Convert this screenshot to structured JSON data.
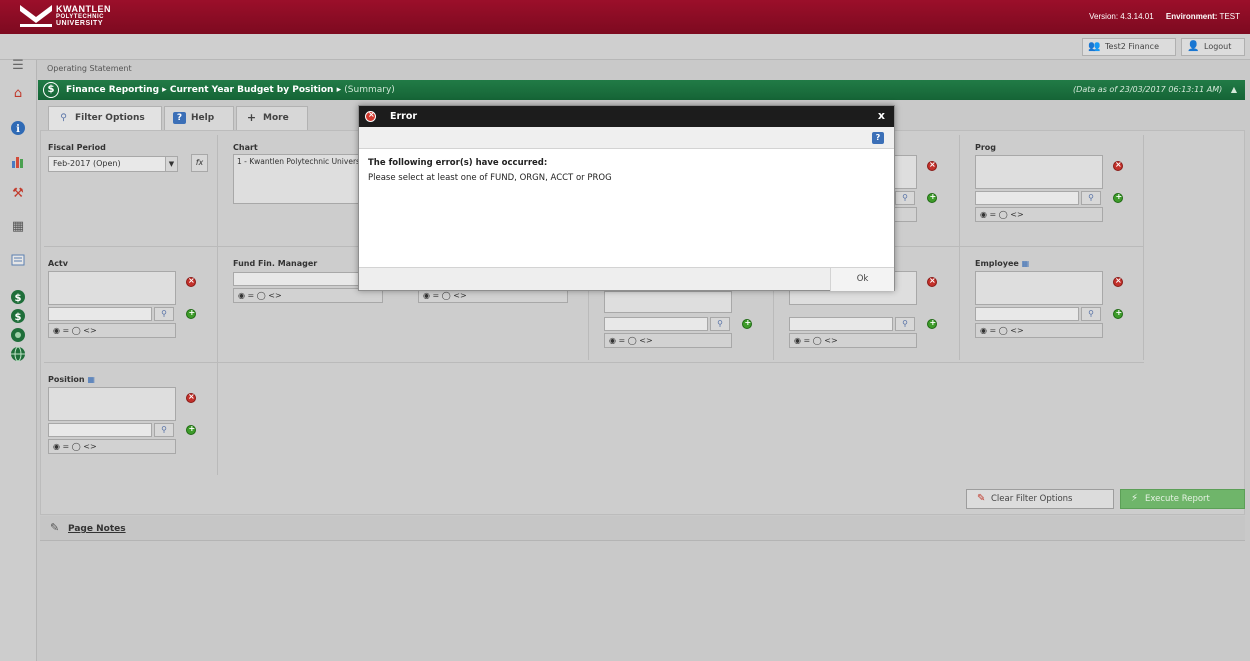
{
  "brand": {
    "line1": "KWANTLEN",
    "line2": "POLYTECHNIC",
    "line3": "UNIVERSITY"
  },
  "header": {
    "version_label": "Version:",
    "version": "4.3.14.01",
    "env_label": "Environment:",
    "env": "TEST"
  },
  "userbar": {
    "user": "Test2 Finance",
    "logout": "Logout"
  },
  "page": {
    "section": "Operating Statement"
  },
  "breadcrumb": {
    "item1": "Finance Reporting",
    "sep": "▸",
    "item2": "Current Year Budget by Position",
    "item3": "(Summary)",
    "as_of": "(Data as of 23/03/2017 06:13:11 AM)",
    "collapse": "▲"
  },
  "tabs": {
    "filter": "Filter Options",
    "help": "Help",
    "more": "More"
  },
  "filters": {
    "fiscal_period": {
      "label": "Fiscal Period",
      "value": "Feb-2017 (Open)",
      "fx": "fx"
    },
    "chart": {
      "label": "Chart",
      "value": "1 - Kwantlen Polytechnic University"
    },
    "prog": {
      "label": "Prog"
    },
    "actv": {
      "label": "Actv"
    },
    "fund_fin_manager": {
      "label": "Fund Fin. Manager"
    },
    "employee": {
      "label": "Employee"
    },
    "position": {
      "label": "Position"
    },
    "radio_text": "◉ = ◯ <>"
  },
  "buttons": {
    "clear": "Clear Filter Options",
    "execute": "Execute Report"
  },
  "notes": {
    "label": "Page Notes"
  },
  "dialog": {
    "title": "Error",
    "close": "x",
    "help": "?",
    "heading": "The following error(s) have occurred:",
    "message": "Please select at least one of FUND, ORGN, ACCT or PROG",
    "ok": "Ok"
  },
  "colors": {
    "brand_red": "#8b0d25",
    "header_green": "#1a6e3d",
    "execute_green": "#6fb56a"
  },
  "icons": {
    "rail": [
      "menu-icon",
      "home-icon",
      "info-icon",
      "chart-icon",
      "tools-icon",
      "save-icon",
      "report-icon",
      "dollar-icon",
      "dollar-icon",
      "fund-icon",
      "globe-icon"
    ]
  }
}
